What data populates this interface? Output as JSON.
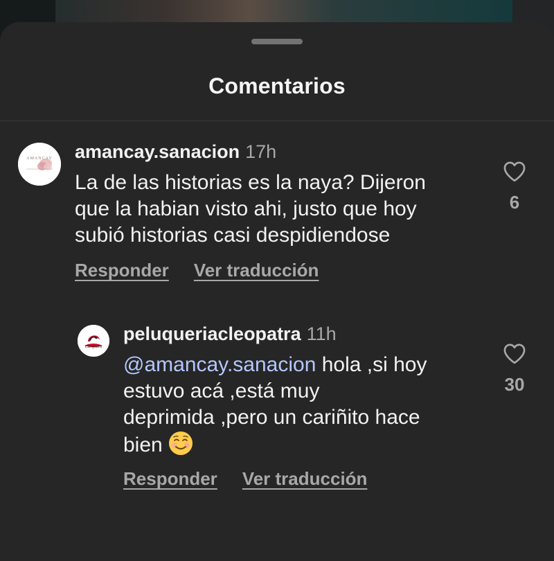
{
  "header": {
    "title": "Comentarios"
  },
  "comments": [
    {
      "username": "amancay.sanacion",
      "time": "17h",
      "avatar_text": "AMANCAY",
      "lines": [
        "La de las historias es la naya? Dijeron",
        "que la habian visto ahi, justo que hoy",
        "subió historias casi despidiendose"
      ],
      "likes": "6",
      "reply_label": "Responder",
      "translate_label": "Ver traducción"
    },
    {
      "username": "peluqueriacleopatra",
      "time": "11h",
      "mention": "@amancay.sanacion",
      "lines": [
        " hola ,si hoy",
        "estuvo acá ,está muy",
        "deprimida ,pero un cariñito hace",
        "bien"
      ],
      "emoji": "smiling-face-emoji",
      "likes": "30",
      "reply_label": "Responder",
      "translate_label": "Ver traducción"
    }
  ],
  "colors": {
    "sheet_bg": "#262626",
    "text_primary": "#f2f2f2",
    "text_secondary": "#a8a8a8",
    "mention": "#b3c7ff"
  }
}
